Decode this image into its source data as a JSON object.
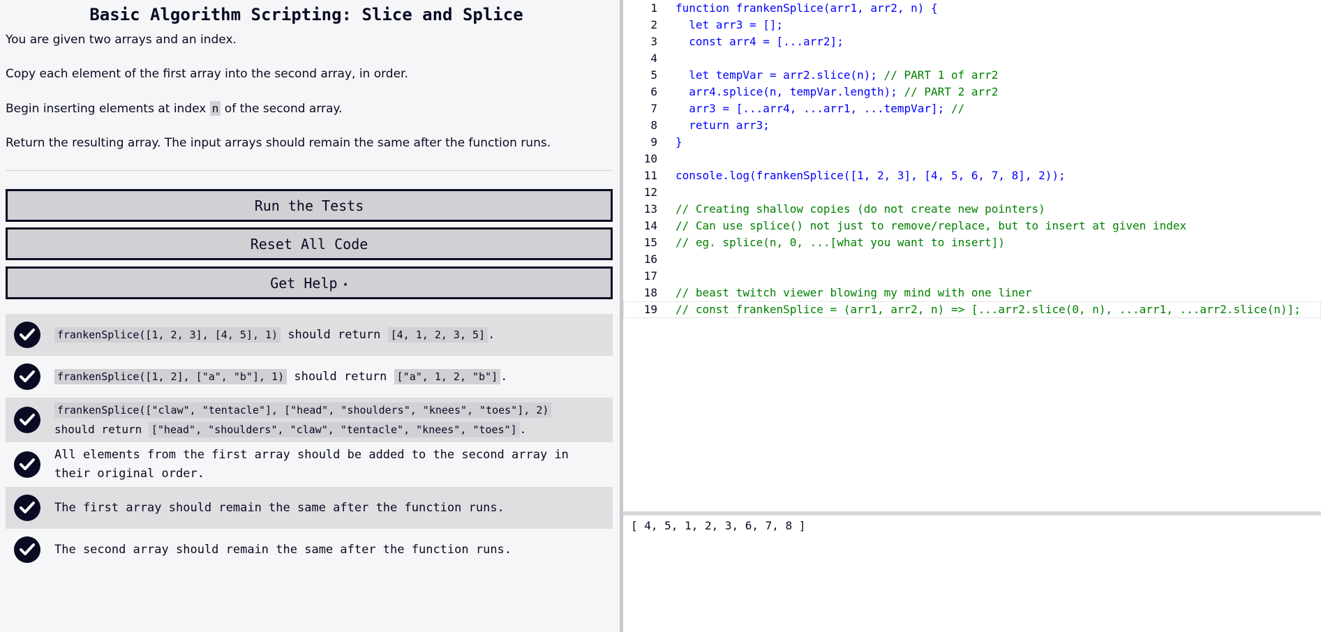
{
  "challenge": {
    "title": "Basic Algorithm Scripting: Slice and Splice",
    "desc1": "You are given two arrays and an index.",
    "desc2": "Copy each element of the first array into the second array, in order.",
    "desc3_before": "Begin inserting elements at index ",
    "desc3_code": "n",
    "desc3_after": " of the second array.",
    "desc4": "Return the resulting array. The input arrays should remain the same after the function runs."
  },
  "buttons": {
    "run": "Run the Tests",
    "reset": "Reset All Code",
    "help": "Get Help",
    "help_caret": "▴"
  },
  "tests": [
    {
      "code": "frankenSplice([1, 2, 3], [4, 5], 1)",
      "mid": " should return ",
      "result": "[4, 1, 2, 3, 5]",
      "end": "."
    },
    {
      "code": "frankenSplice([1, 2], [\"a\", \"b\"], 1)",
      "mid": " should return ",
      "result": "[\"a\", 1, 2, \"b\"]",
      "end": "."
    },
    {
      "code": "frankenSplice([\"claw\", \"tentacle\"], [\"head\", \"shoulders\", \"knees\", \"toes\"], 2)",
      "mid": " should return ",
      "result": "[\"head\", \"shoulders\", \"claw\", \"tentacle\", \"knees\", \"toes\"]",
      "end": "."
    },
    {
      "text": "All elements from the first array should be added to the second array in their original order."
    },
    {
      "text": "The first array should remain the same after the function runs."
    },
    {
      "text": "The second array should remain the same after the function runs."
    }
  ],
  "editor": {
    "lines": [
      {
        "n": "1",
        "code": "function frankenSplice(arr1, arr2, n) {"
      },
      {
        "n": "2",
        "code": "  let arr3 = [];"
      },
      {
        "n": "3",
        "code": "  const arr4 = [...arr2];"
      },
      {
        "n": "4",
        "code": ""
      },
      {
        "n": "5",
        "code": "  let tempVar = arr2.slice(n); ",
        "comment": "// PART 1 of arr2"
      },
      {
        "n": "6",
        "code": "  arr4.splice(n, tempVar.length); ",
        "comment": "// PART 2 arr2"
      },
      {
        "n": "7",
        "code": "  arr3 = [...arr4, ...arr1, ...tempVar]; ",
        "comment": "//"
      },
      {
        "n": "8",
        "code": "  return arr3;"
      },
      {
        "n": "9",
        "code": "}"
      },
      {
        "n": "10",
        "code": ""
      },
      {
        "n": "11",
        "code": "console.log(frankenSplice([1, 2, 3], [4, 5, 6, 7, 8], 2));"
      },
      {
        "n": "12",
        "code": ""
      },
      {
        "n": "13",
        "code": "",
        "comment": "// Creating shallow copies (do not create new pointers)"
      },
      {
        "n": "14",
        "code": "",
        "comment": "// Can use splice() not just to remove/replace, but to insert at given index"
      },
      {
        "n": "15",
        "code": "",
        "comment": "// eg. splice(n, 0, ...[what you want to insert])"
      },
      {
        "n": "16",
        "code": ""
      },
      {
        "n": "17",
        "code": ""
      },
      {
        "n": "18",
        "code": "",
        "comment": "// beast twitch viewer blowing my mind with one liner"
      },
      {
        "n": "19",
        "code": "",
        "comment": "// const frankenSplice = (arr1, arr2, n) => [...arr2.slice(0, n), ...arr1, ...arr2.slice(n)];",
        "active": true
      }
    ]
  },
  "console": {
    "output": "[ 4, 5, 1, 2, 3, 6, 7, 8 ]"
  },
  "colors": {
    "text": "#0a0a23",
    "button_bg": "#d0d0d5",
    "keyword": "#0000ff",
    "comment": "#008000"
  },
  "icons": {
    "passed": "checkmark-circle-icon"
  }
}
